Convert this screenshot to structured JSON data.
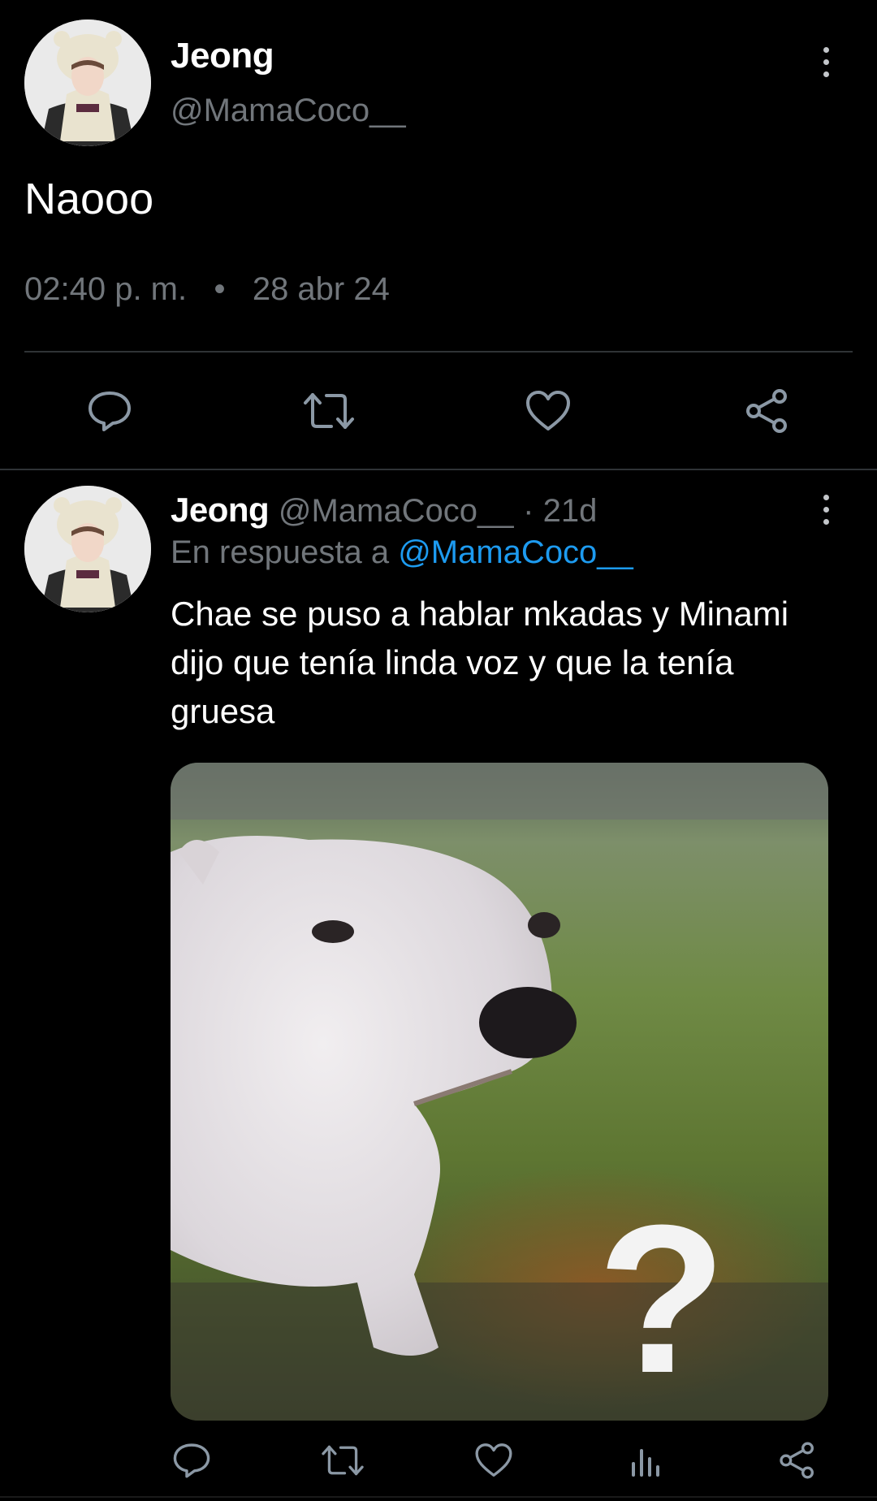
{
  "main_tweet": {
    "author_name": "Jeong",
    "author_handle": "@MamaCoco__",
    "text": "Naooo",
    "time": "02:40 p. m.",
    "separator": "•",
    "date": "28 abr 24",
    "actions": [
      "reply-icon",
      "retweet-icon",
      "like-icon",
      "share-icon"
    ]
  },
  "reply_tweet": {
    "author_name": "Jeong",
    "author_handle": "@MamaCoco__",
    "age": "· 21d",
    "reply_prefix": "En respuesta a",
    "reply_mention": "@MamaCoco__",
    "text": "Chae se puso a hablar mkadas y Minami dijo que tenía linda voz y que la tenía gruesa",
    "media_overlay": "?",
    "actions": [
      "reply-icon",
      "retweet-icon",
      "like-icon",
      "views-icon",
      "share-icon"
    ]
  },
  "colors": {
    "background": "#000000",
    "text_primary": "#e7e9ea",
    "text_secondary": "#71767b",
    "link": "#1d9bf0",
    "divider": "#2f3336",
    "icon": "#8b98a5"
  }
}
